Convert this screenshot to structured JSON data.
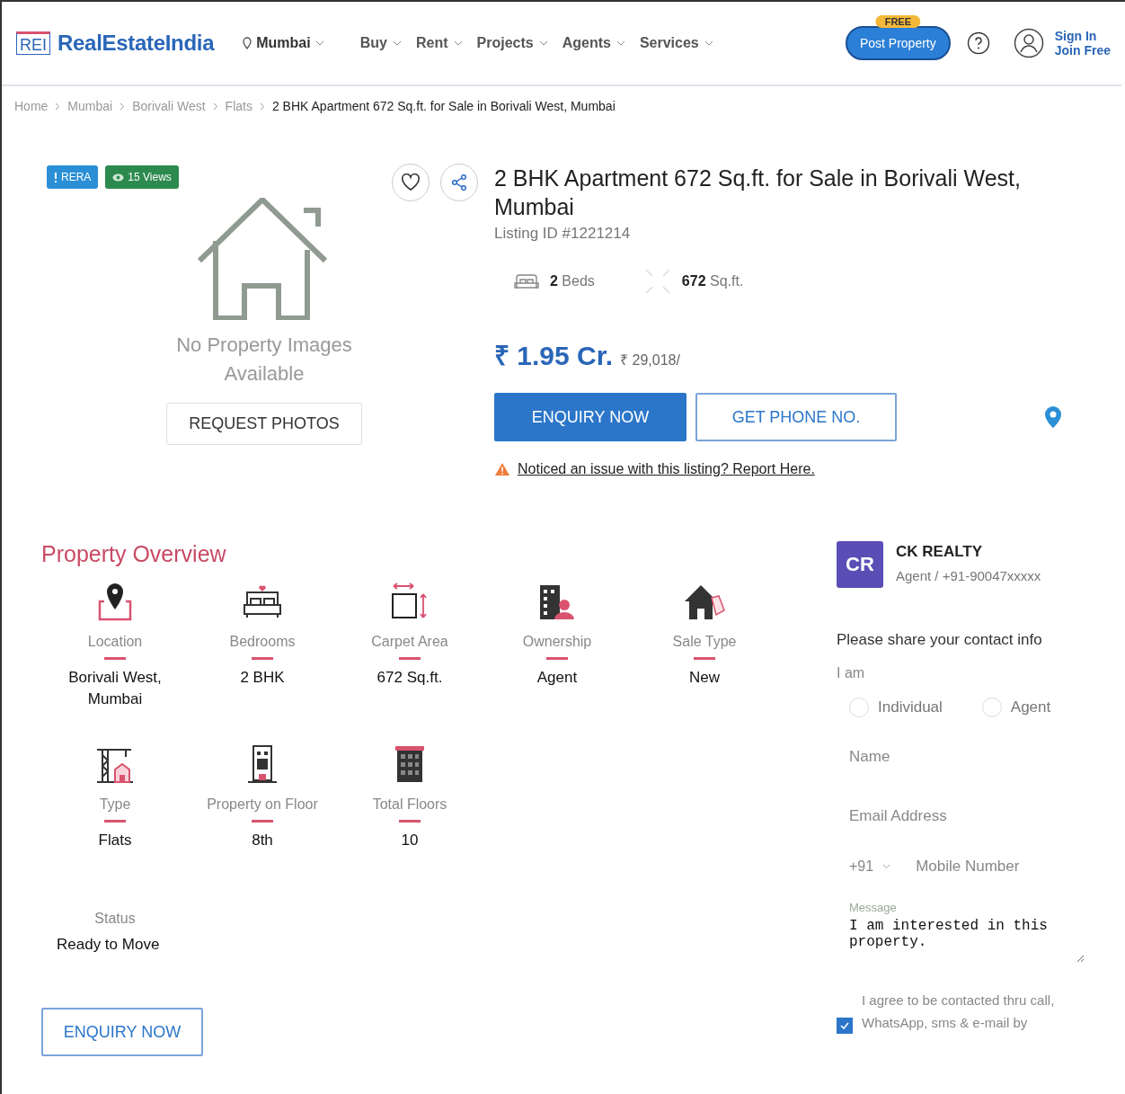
{
  "header": {
    "logo": {
      "mark": "REI",
      "name": "RealEstateIndia"
    },
    "city": "Mumbai",
    "nav": [
      "Buy",
      "Rent",
      "Projects",
      "Agents",
      "Services"
    ],
    "post_property": {
      "label": "Post Property",
      "badge": "FREE"
    },
    "sign_in": "Sign In",
    "join": "Join Free"
  },
  "breadcrumb": [
    "Home",
    "Mumbai",
    "Borivali West",
    "Flats",
    "2 BHK Apartment 672 Sq.ft. for Sale in Borivali West, Mumbai"
  ],
  "gallery": {
    "badges": [
      {
        "kind": "rera",
        "label": "RERA"
      },
      {
        "kind": "views",
        "label": "15 Views"
      }
    ],
    "message": "No Property Images Available",
    "button": "REQUEST PHOTOS"
  },
  "listing": {
    "title": "2 BHK Apartment 672 Sq.ft. for Sale in Borivali West, Mumbai",
    "listing_id": "Listing ID #1221214",
    "features": [
      {
        "kind": "beds",
        "value": "2",
        "unit": "Beds"
      },
      {
        "kind": "area",
        "value": "672",
        "unit": "Sq.ft."
      }
    ],
    "price": "₹ 1.95 Cr.",
    "price_per_unit": "₹ 29,018/",
    "enquiry_button": "ENQUIRY NOW",
    "phone_button": "GET PHONE NO.",
    "report": "Noticed an issue with this listing? Report Here."
  },
  "overview": {
    "title": "Property Overview",
    "items": [
      {
        "kind": "location",
        "label": "Location",
        "value": "Borivali West, Mumbai"
      },
      {
        "kind": "bedrooms",
        "label": "Bedrooms",
        "value": "2 BHK"
      },
      {
        "kind": "area",
        "label": "Carpet Area",
        "value": "672 Sq.ft."
      },
      {
        "kind": "ownership",
        "label": "Ownership",
        "value": "Agent"
      },
      {
        "kind": "sale",
        "label": "Sale Type",
        "value": "New"
      },
      {
        "kind": "type",
        "label": "Type",
        "value": "Flats"
      },
      {
        "kind": "floor",
        "label": "Property on Floor",
        "value": "8th"
      },
      {
        "kind": "floors",
        "label": "Total Floors",
        "value": "10"
      }
    ],
    "status": {
      "label": "Status",
      "value": "Ready to Move"
    },
    "button": "ENQUIRY NOW"
  },
  "agent": {
    "initials": "CR",
    "name": "CK REALTY",
    "meta": "Agent / +91-90047xxxxx"
  },
  "form": {
    "prompt": "Please share your contact info",
    "i_am": "I am",
    "roles": [
      {
        "label": "Individual",
        "selected": false
      },
      {
        "label": "Agent",
        "selected": false
      }
    ],
    "name_placeholder": "Name",
    "email_placeholder": "Email Address",
    "country_code": "+91",
    "mobile_placeholder": "Mobile Number",
    "message_label": "Message",
    "message": "I am interested in this property.",
    "consent": "I agree to be contacted thru call, WhatsApp, sms & e-mail by",
    "consent_checked": true
  }
}
